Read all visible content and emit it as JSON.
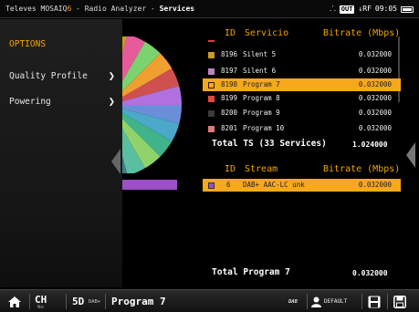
{
  "topbar": {
    "app": "Televes MOSAIQ",
    "q_mark": "6",
    "separator": " - Radio Analyzer - ",
    "section": "Services",
    "net_icon": "network-icon",
    "out_badge": "OUT",
    "rf_label": "↓RF",
    "time": "09:05",
    "battery_icon": "battery-icon"
  },
  "menu": {
    "title": "OPTIONS",
    "items": [
      {
        "label": "Quality Profile",
        "icon": "chevron-right-icon"
      },
      {
        "label": "Powering",
        "icon": "chevron-right-icon"
      }
    ]
  },
  "services_table": {
    "headers": {
      "id": "ID",
      "name": "Servicio",
      "bitrate": "Bitrate (Mbps)"
    },
    "rows": [
      {
        "id": "8196",
        "name": "Silent 5",
        "bitrate": "0.032000",
        "color": "#c89a2a",
        "selected": false
      },
      {
        "id": "8197",
        "name": "Silent 6",
        "bitrate": "0.032000",
        "color": "#c080c8",
        "selected": false
      },
      {
        "id": "8198",
        "name": "Program 7",
        "bitrate": "0.032000",
        "color": "#f7a81b",
        "selected": true
      },
      {
        "id": "8199",
        "name": "Program 8",
        "bitrate": "0.032000",
        "color": "#e04a3a",
        "selected": false
      },
      {
        "id": "8200",
        "name": "Program 9",
        "bitrate": "0.032000",
        "color": "#3a3a3a",
        "selected": false
      },
      {
        "id": "8201",
        "name": "Program 10",
        "bitrate": "0.032000",
        "color": "#e07878",
        "selected": false
      }
    ],
    "total_label": "Total TS (33 Services)",
    "total_value": "1.024000"
  },
  "stream_table": {
    "headers": {
      "id": "ID",
      "name": "Stream",
      "bitrate": "Bitrate (Mbps)"
    },
    "rows": [
      {
        "id": "6",
        "name": "DAB+ AAC-LC  unk",
        "bitrate": "0.032000",
        "color": "#9b4fc8",
        "selected": true
      }
    ],
    "total_label": "Total Program 7",
    "total_value": "0.032000"
  },
  "bottombar": {
    "home_icon": "home-icon",
    "ch_label": "CH",
    "ch_sub": "MHz",
    "channel": "5D",
    "band": "DAB+",
    "program": "Program 7",
    "dab_logo": "DAB",
    "user_icon": "user-icon",
    "profile": "DEFAULT",
    "save_icon": "save-icon",
    "save_as_icon": "save-as-icon"
  },
  "colors": {
    "accent": "#f0a500",
    "selection": "#f7a81b",
    "stream_purple": "#9b4fc8"
  },
  "pie_slices": [
    "#c89a2a",
    "#e85b9a",
    "#7bd36f",
    "#f0a030",
    "#d05050",
    "#b070e0",
    "#6a8fd8",
    "#4aa8c8",
    "#3fb38a",
    "#8fd36a",
    "#5abfa0",
    "#3a8090"
  ]
}
